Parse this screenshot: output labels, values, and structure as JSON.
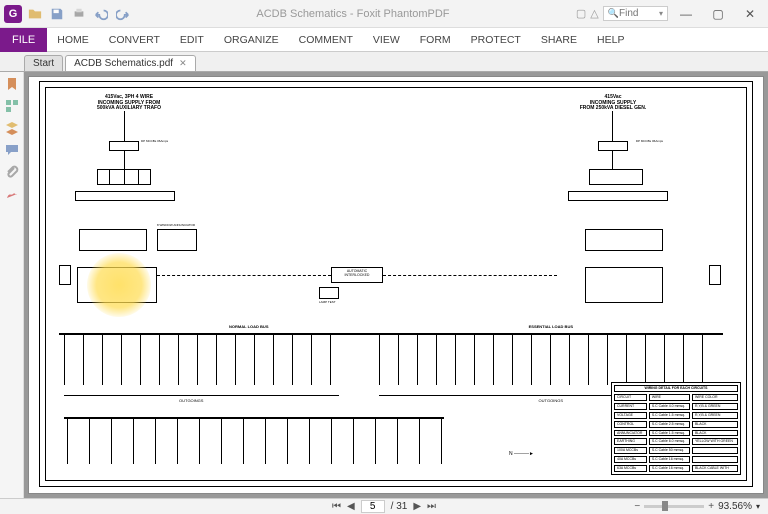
{
  "titlebar": {
    "app_glyph": "G",
    "doc_title": "ACDB Schematics - Foxit PhantomPDF",
    "find_placeholder": "Find"
  },
  "ribbon": {
    "file": "FILE",
    "tabs": [
      "HOME",
      "CONVERT",
      "EDIT",
      "ORGANIZE",
      "COMMENT",
      "VIEW",
      "FORM",
      "PROTECT",
      "SHARE",
      "HELP"
    ]
  },
  "doctabs": {
    "start": "Start",
    "current": "ACDB Schematics.pdf"
  },
  "schematic": {
    "left_header_1": "415Vac, 3PH 4 WIRE",
    "left_header_2": "INCOMING SUPPLY FROM",
    "left_header_3": "500kVA AUXILIARY TRAFO",
    "right_header_1": "415Vac",
    "right_header_2": "INCOMING SUPPLY",
    "right_header_3": "FROM 250kVA DIESEL GEN.",
    "auto_interlock_1": "AUTOMATIC",
    "auto_interlock_2": "INTERLOCKED",
    "normal_bus": "NORMAL LOAD BUS",
    "essential_bus": "ESSENTIAL LOAD BUS",
    "outgoings_left": "OUTGOINGS",
    "outgoings_right": "OUTGOINGS",
    "tp_mccb_1": "DP MCCBs 06Amps",
    "tp_mccb_2": "DP MCCBs 06Amps",
    "annunciator": "8 WINDOW ANNUNCIATOR",
    "lamp_test": "LAMP TEST",
    "wiring_title": "WIRING DETAIL FOR EACH CIRCUITS",
    "wiring_headers": [
      "CIRCUIT",
      "WIRE",
      "WIRE COLOR"
    ],
    "wiring_rows": [
      [
        "CURRENT",
        "S.C Cable 4.0 mmsq.",
        "R,Y,B & GREEN"
      ],
      [
        "VOLTAGE",
        "S.C Cable 1.5 mmsq.",
        "R,Y,B & GREEN"
      ],
      [
        "CONTROL",
        "S.C Cable 2.5 mmsq.",
        "BLACK"
      ],
      [
        "ANNUNCIATOR",
        "S.C Cable 1.5 mmsq.",
        "BLACK"
      ],
      [
        "EARTHING",
        "S.C Cable 6.0 mmsq.",
        "YELLOW WITH GREEN"
      ],
      [
        "100A MCCBs",
        "S.C Cable 50 mmsq.",
        ""
      ],
      [
        "40A MCCBs",
        "S.C Cable 16 mmsq.",
        ""
      ],
      [
        "63A MCCBs",
        "S.C Cable 16 mmsq.",
        "BLACK CABLE WITH"
      ]
    ]
  },
  "statusbar": {
    "page_current": "5",
    "page_total": "/ 31",
    "zoom": "93.56%"
  }
}
